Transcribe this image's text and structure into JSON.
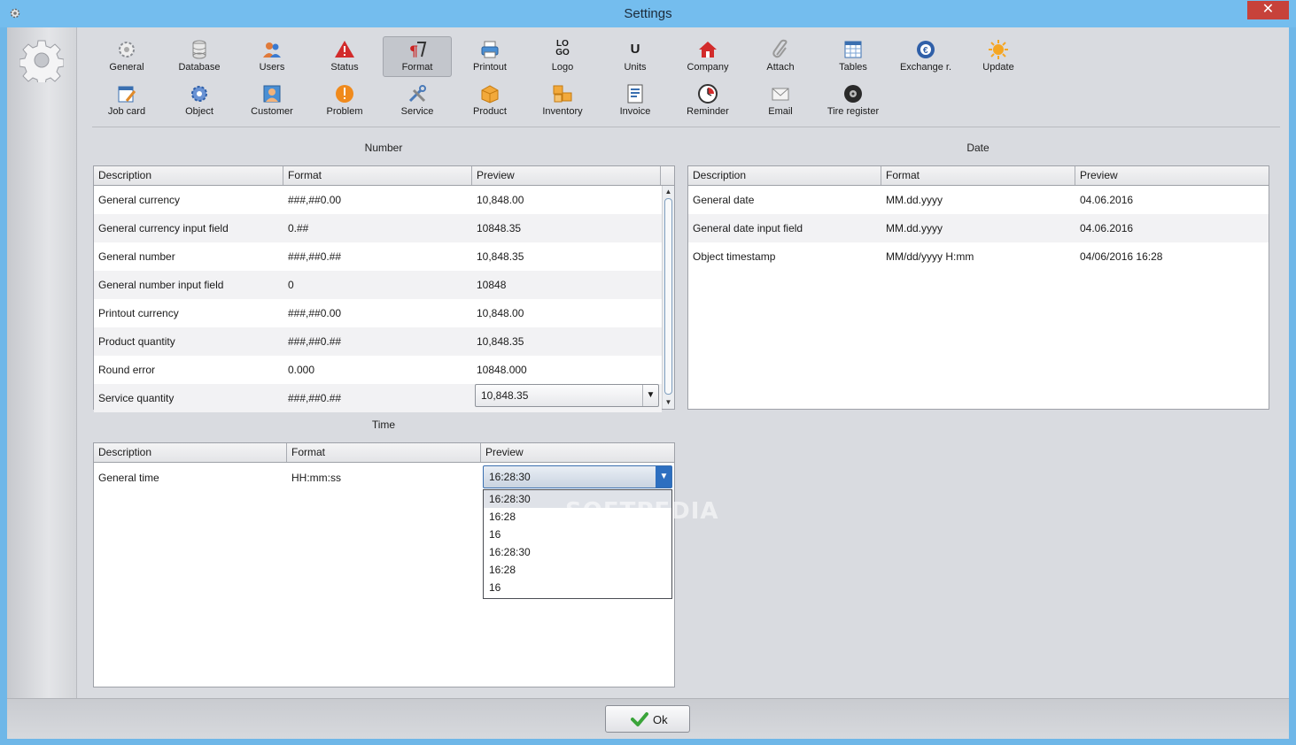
{
  "window": {
    "title": "Settings",
    "close_glyph": "✕"
  },
  "toolbar": {
    "row1": [
      {
        "key": "general",
        "label": "General",
        "icon": "gear-icon"
      },
      {
        "key": "database",
        "label": "Database",
        "icon": "database-icon"
      },
      {
        "key": "users",
        "label": "Users",
        "icon": "users-icon"
      },
      {
        "key": "status",
        "label": "Status",
        "icon": "warning-icon"
      },
      {
        "key": "format",
        "label": "Format",
        "icon": "format-icon"
      },
      {
        "key": "printout",
        "label": "Printout",
        "icon": "printer-icon"
      },
      {
        "key": "logo",
        "label": "Logo",
        "icon": "logo-icon"
      },
      {
        "key": "units",
        "label": "Units",
        "icon": "units-icon"
      },
      {
        "key": "company",
        "label": "Company",
        "icon": "house-icon"
      },
      {
        "key": "attach",
        "label": "Attach",
        "icon": "paperclip-icon"
      },
      {
        "key": "tables",
        "label": "Tables",
        "icon": "table-icon"
      },
      {
        "key": "exchange",
        "label": "Exchange r.",
        "icon": "exchange-icon"
      },
      {
        "key": "update",
        "label": "Update",
        "icon": "sun-update-icon"
      }
    ],
    "row2": [
      {
        "key": "job_card",
        "label": "Job card",
        "icon": "job-card-icon"
      },
      {
        "key": "object",
        "label": "Object",
        "icon": "gear-blue-icon"
      },
      {
        "key": "customer",
        "label": "Customer",
        "icon": "customer-card-icon"
      },
      {
        "key": "problem",
        "label": "Problem",
        "icon": "exclamation-icon"
      },
      {
        "key": "service",
        "label": "Service",
        "icon": "tools-icon"
      },
      {
        "key": "product",
        "label": "Product",
        "icon": "box-icon"
      },
      {
        "key": "inventory",
        "label": "Inventory",
        "icon": "boxes-icon"
      },
      {
        "key": "invoice",
        "label": "Invoice",
        "icon": "invoice-icon"
      },
      {
        "key": "reminder",
        "label": "Reminder",
        "icon": "clock-icon"
      },
      {
        "key": "email",
        "label": "Email",
        "icon": "envelope-icon"
      },
      {
        "key": "tire_register",
        "label": "Tire register",
        "icon": "tire-icon"
      }
    ],
    "logo_text_top": "LO",
    "logo_text_bottom": "GO",
    "units_text": "U",
    "active": "format"
  },
  "number": {
    "title": "Number",
    "headers": [
      "Description",
      "Format",
      "Preview"
    ],
    "rows": [
      [
        "General currency",
        "###,##0.00",
        "10,848.00"
      ],
      [
        "General currency input field",
        "0.##",
        "10848.35"
      ],
      [
        "General number",
        "###,##0.##",
        "10,848.35"
      ],
      [
        "General number input field",
        "0",
        "10848"
      ],
      [
        "Printout currency",
        "###,##0.00",
        "10,848.00"
      ],
      [
        "Product quantity",
        "###,##0.##",
        "10,848.35"
      ],
      [
        "Round error",
        "0.000",
        "10848.000"
      ],
      [
        "Service quantity",
        "###,##0.##",
        "10,848.35"
      ]
    ],
    "scroll_up": "▲",
    "scroll_down": "▼"
  },
  "date": {
    "title": "Date",
    "headers": [
      "Description",
      "Format",
      "Preview"
    ],
    "rows": [
      [
        "General date",
        "MM.dd.yyyy",
        "04.06.2016"
      ],
      [
        "General date input field",
        "MM.dd.yyyy",
        "04.06.2016"
      ],
      [
        "Object timestamp",
        "MM/dd/yyyy H:mm",
        "04/06/2016 16:28"
      ]
    ]
  },
  "time": {
    "title": "Time",
    "headers": [
      "Description",
      "Format",
      "Preview"
    ],
    "rows": [
      [
        "General time",
        "HH:mm:ss",
        "16:28:30"
      ]
    ],
    "dropdown_options": [
      "16:28:30",
      "16:28",
      "16",
      "16:28:30",
      "16:28",
      "16"
    ]
  },
  "dropdown_glyph": "▼",
  "watermark": "SOFTPEDIA",
  "ok_button": {
    "label": "Ok"
  },
  "colors": {
    "titlebar": "#74bdee",
    "close": "#c7423a",
    "accent": "#2d6fc0"
  }
}
